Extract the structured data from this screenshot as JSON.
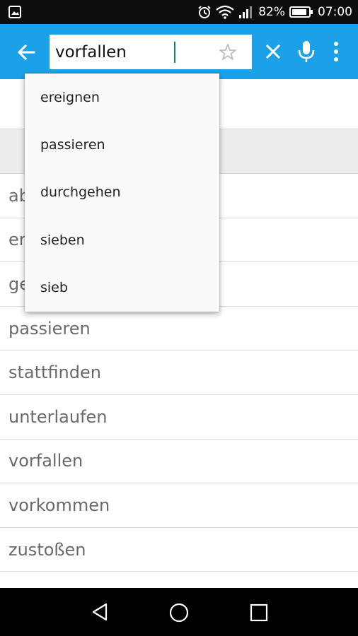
{
  "status_bar": {
    "battery": "82%",
    "time": "07:00",
    "icons": [
      "image-notification-icon",
      "alarm-icon",
      "wifi-icon",
      "signal-icon",
      "battery-icon"
    ]
  },
  "toolbar": {
    "search_value": "vorfallen",
    "accent_color": "#1ba1e8",
    "icons": [
      "back-arrow-icon",
      "star-outline-icon",
      "close-icon",
      "microphone-icon",
      "more-vert-icon"
    ]
  },
  "suggestions": [
    "ereignen",
    "passieren",
    "durchgehen",
    "sieben",
    "sieb"
  ],
  "results": [
    "ab",
    "er",
    "ge",
    "passieren",
    "stattfinden",
    "unterlaufen",
    "vorfallen",
    "vorkommen",
    "zustoßen"
  ],
  "nav_bar": {
    "icons": [
      "nav-back-icon",
      "nav-home-icon",
      "nav-recents-icon"
    ]
  }
}
